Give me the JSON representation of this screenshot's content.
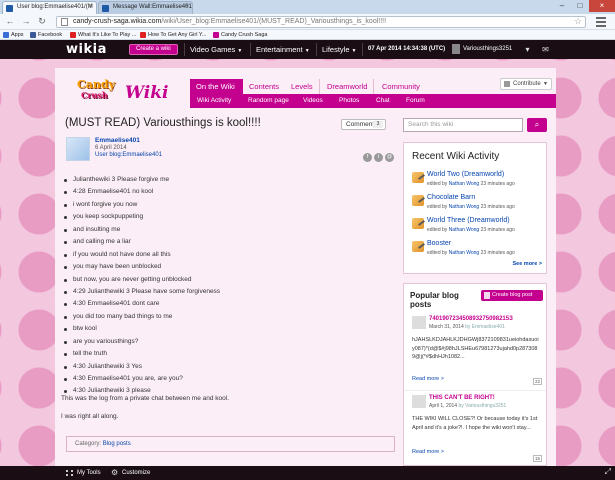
{
  "browser": {
    "tabs": [
      {
        "label": "User blog:Emmaelise401/(M",
        "active": true
      },
      {
        "label": "Message Wall:Emmaelise401",
        "active": false
      }
    ],
    "url_host": "candy-crush-saga.wikia.com",
    "url_path": "/wiki/User_blog:Emmaelise401/(MUST_READ)_Variousthings_is_kool!!!!",
    "bookmarks": [
      {
        "label": "Apps",
        "color": "#3b6fd8"
      },
      {
        "label": "Facebook",
        "color": "#3b5998"
      },
      {
        "label": "What It's Like To Play ...",
        "color": "#e02020"
      },
      {
        "label": "How To Get Any Girl Y...",
        "color": "#e02020"
      },
      {
        "label": "Candy Crush Saga",
        "color": "#c4008f"
      }
    ]
  },
  "globalnav": {
    "logo": "wikia",
    "create_wiki": "Create a wiki",
    "hubs": [
      "Video Games",
      "Entertainment",
      "Lifestyle"
    ],
    "datetime": "07 Apr 2014 14:34:38 (UTC)",
    "username": "Variousthings3251"
  },
  "wiki": {
    "wordmark": {
      "candy": "Candy",
      "crush": "Crush",
      "wiki": "Wiki"
    },
    "tabs": [
      "On the Wiki",
      "Contents",
      "Levels",
      "Dreamworld",
      "Community"
    ],
    "subnav": [
      "Wiki Activity",
      "Random page",
      "Videos",
      "Photos",
      "Chat",
      "Forum"
    ],
    "contribute": "Contribute"
  },
  "article": {
    "title": "(MUST READ) Variousthings is kool!!!!",
    "comments_label": "Comments",
    "comments_count": "3",
    "author_name": "Emmaelise401",
    "author_date": "6 April 2014",
    "author_blog": "User blog:Emmaelise401",
    "chat_lines": [
      "Julianthewiki 3 Please forgive me",
      "4:28 Emmaelise401 no kool",
      "i wont forgive you now",
      "you keep sockpuppeting",
      "and insulting me",
      "and calling me a liar",
      "if you would not have done all this",
      "you may have been unblocked",
      "but now, you are never getting unblocked",
      "4:29 Julianthewiki 3 Please have some forgiveness",
      "4:30 Emmaelise401 dont care",
      "you did too many bad things to me",
      "btw kool",
      "are you variousthings?",
      "tell the truth",
      "4:30 Julianthewiki 3 Yes",
      "4:30 Emmaelise401 you are, are you?",
      "4:30 Julianthewiki 3 please"
    ],
    "footnote1": "This was the log from a private chat between me and kool.",
    "footnote2": "I was right all along.",
    "category_label": "Category:",
    "category_value": "Blog posts"
  },
  "rail": {
    "search_placeholder": "Search this wiki",
    "activity_title": "Recent Wiki Activity",
    "activity": [
      {
        "title": "World Two (Dreamworld)",
        "editor": "Nathan Wong",
        "when": "23 minutes ago"
      },
      {
        "title": "Chocolate Barn",
        "editor": "Nathan Wong",
        "when": "23 minutes ago"
      },
      {
        "title": "World Three (Dreamworld)",
        "editor": "Nathan Wong",
        "when": "23 minutes ago"
      },
      {
        "title": "Booster",
        "editor": "Nathan Wong",
        "when": "23 minutes ago"
      }
    ],
    "edited_by": "edited by",
    "see_more": "See more >",
    "popular_title": "Popular blog posts",
    "create_blog": "Create blog post",
    "posts": [
      {
        "title": "740190723450893275098215З",
        "date": "March 31, 2014",
        "by": "by Emmaelise401",
        "body": "hJAHSLKDJAHLKJDHGWj8372109831ueiohdasuoiy087)*(d@$#j98hJLSHEu67981273ujahd0p2873089@j(*#$dhHJh1082...",
        "read_more": "Read more >",
        "comments": "22"
      },
      {
        "title": "THIS CAN'T BE RIGHT!",
        "date": "April 1, 2014",
        "by": "by Variousthings3251",
        "body": "THE WIKI WILL CLOSE?! Or because today it's 1st April and it's a joke?!. I hope the wiki won't stay...",
        "read_more": "Read more >",
        "comments": "15"
      }
    ]
  },
  "toolbar": {
    "my_tools": "My Tools",
    "customize": "Customize"
  }
}
